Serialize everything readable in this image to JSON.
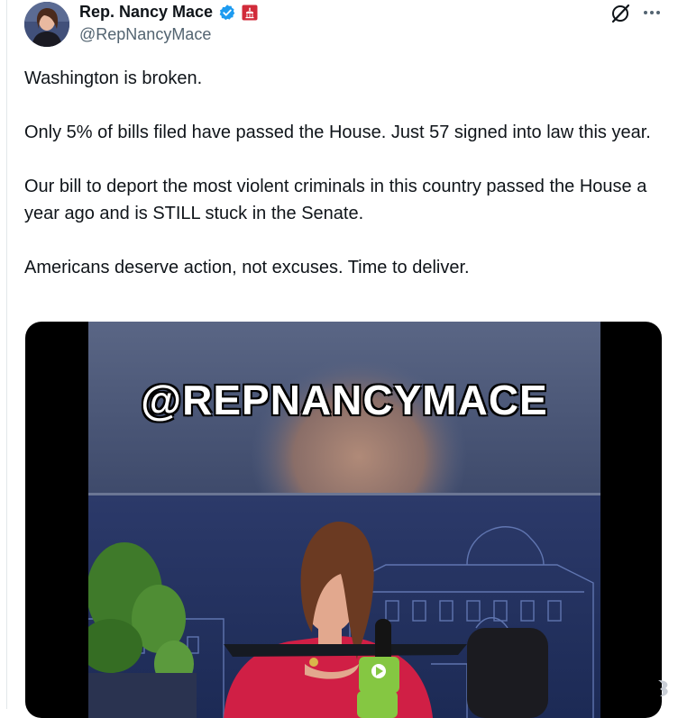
{
  "author": {
    "display_name": "Rep. Nancy Mace",
    "handle": "@RepNancyMace"
  },
  "icons": {
    "verified": "verified-badge-icon",
    "affiliation": "us-house-affiliation-icon",
    "grok": "grok-icon",
    "more": "more-options-icon"
  },
  "tweet": {
    "paragraphs": [
      "Washington is broken.",
      "Only 5% of bills filed have passed the House. Just 57 signed into law this year.",
      "Our bill to deport the most violent criminals in this country passed the House a year ago and is STILL stuck in the Senate.",
      "Americans deserve action, not excuses. Time to deliver."
    ]
  },
  "media": {
    "overlay_text": "@REPNANCYMACE",
    "mic_brand": "rumble"
  },
  "colors": {
    "text": "#0f1419",
    "secondary_text": "#536471",
    "verified_blue": "#1d9bf0",
    "affiliation_red": "#d12b3a",
    "rumble_green": "#85c742"
  }
}
